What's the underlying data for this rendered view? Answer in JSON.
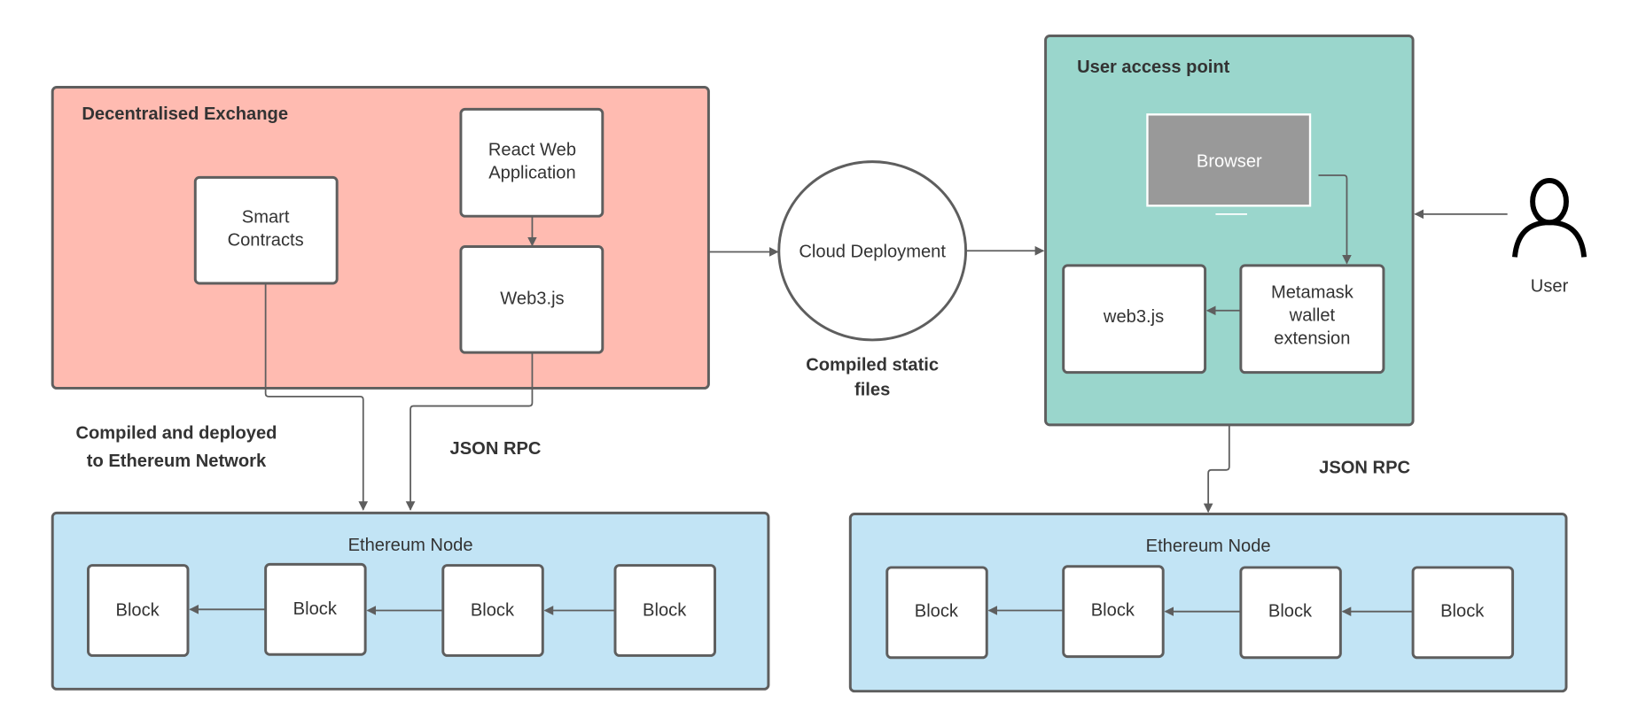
{
  "colors": {
    "dex": "#ffbbb1",
    "user_access": "#9ad6cc",
    "eth_node": "#c2e4f5",
    "browser": "#999999",
    "stroke": "#5e5e5e"
  },
  "dex": {
    "title": "Decentralised Exchange",
    "react": [
      "React Web",
      "Application"
    ],
    "smart_contracts": [
      "Smart",
      "Contracts"
    ],
    "web3": "Web3.js"
  },
  "cloud": {
    "label": "Cloud Deployment",
    "caption": [
      "Compiled static",
      "files"
    ]
  },
  "user_access": {
    "title": "User access point",
    "browser": "Browser",
    "metamask": [
      "Metamask",
      "wallet",
      "extension"
    ],
    "web3": "web3.js"
  },
  "user": {
    "label": "User",
    "icon": "person-icon"
  },
  "annotations": {
    "compiled": [
      "Compiled and deployed",
      "to Ethereum Network"
    ],
    "json_rpc_left": "JSON RPC",
    "json_rpc_right": "JSON RPC"
  },
  "eth_left": {
    "title": "Ethereum Node",
    "blocks": [
      "Block",
      "Block",
      "Block",
      "Block"
    ]
  },
  "eth_right": {
    "title": "Ethereum Node",
    "blocks": [
      "Block",
      "Block",
      "Block",
      "Block"
    ]
  }
}
